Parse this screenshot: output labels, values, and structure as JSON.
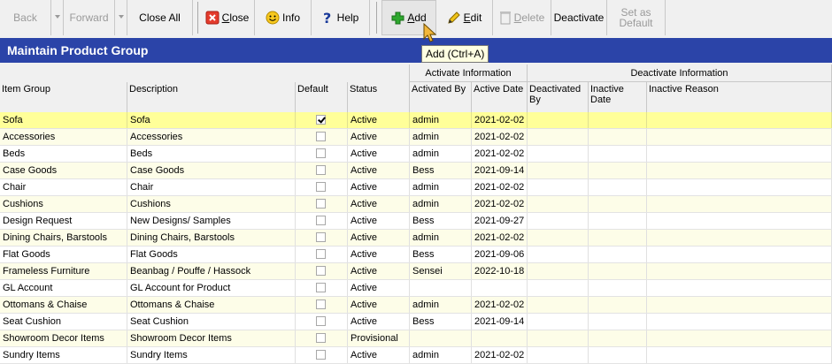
{
  "toolbar": {
    "back": "Back",
    "forward": "Forward",
    "close_all": "Close All",
    "close": "Close",
    "close_mnemonic": "C",
    "info": "Info",
    "help": "Help",
    "add": "Add",
    "add_mnemonic": "A",
    "edit": "Edit",
    "edit_mnemonic": "E",
    "delete": "Delete",
    "delete_mnemonic": "D",
    "deactivate": "Deactivate",
    "set_as_default_line1": "Set as",
    "set_as_default_line2": "Default"
  },
  "tooltip": "Add (Ctrl+A)",
  "page_title": "Maintain Product Group",
  "grid": {
    "group_headers": {
      "activate": "Activate Information",
      "deactivate": "Deactivate Information"
    },
    "columns": {
      "item_group": "Item Group",
      "description": "Description",
      "default": "Default",
      "status": "Status",
      "activated_by": "Activated By",
      "active_date": "Active Date",
      "deactivated_by_1": "Deactivated",
      "deactivated_by_2": "By",
      "inactive_date_1": "Inactive",
      "inactive_date_2": "Date",
      "inactive_reason": "Inactive Reason"
    },
    "rows": [
      {
        "group": "Sofa",
        "description": "Sofa",
        "default": true,
        "status": "Active",
        "activated_by": "admin",
        "active_date": "2021-02-02"
      },
      {
        "group": "Accessories",
        "description": "Accessories",
        "default": false,
        "status": "Active",
        "activated_by": "admin",
        "active_date": "2021-02-02"
      },
      {
        "group": "Beds",
        "description": "Beds",
        "default": false,
        "status": "Active",
        "activated_by": "admin",
        "active_date": "2021-02-02"
      },
      {
        "group": "Case Goods",
        "description": "Case Goods",
        "default": false,
        "status": "Active",
        "activated_by": "Bess",
        "active_date": "2021-09-14"
      },
      {
        "group": "Chair",
        "description": "Chair",
        "default": false,
        "status": "Active",
        "activated_by": "admin",
        "active_date": "2021-02-02"
      },
      {
        "group": "Cushions",
        "description": "Cushions",
        "default": false,
        "status": "Active",
        "activated_by": "admin",
        "active_date": "2021-02-02"
      },
      {
        "group": "Design Request",
        "description": "New Designs/ Samples",
        "default": false,
        "status": "Active",
        "activated_by": "Bess",
        "active_date": "2021-09-27"
      },
      {
        "group": "Dining Chairs, Barstools",
        "description": "Dining Chairs, Barstools",
        "default": false,
        "status": "Active",
        "activated_by": "admin",
        "active_date": "2021-02-02"
      },
      {
        "group": "Flat Goods",
        "description": "Flat Goods",
        "default": false,
        "status": "Active",
        "activated_by": "Bess",
        "active_date": "2021-09-06"
      },
      {
        "group": "Frameless Furniture",
        "description": "Beanbag / Pouffe / Hassock",
        "default": false,
        "status": "Active",
        "activated_by": "Sensei",
        "active_date": "2022-10-18"
      },
      {
        "group": "GL Account",
        "description": "GL Account for Product",
        "default": false,
        "status": "Active",
        "activated_by": "",
        "active_date": ""
      },
      {
        "group": "Ottomans & Chaise",
        "description": "Ottomans & Chaise",
        "default": false,
        "status": "Active",
        "activated_by": "admin",
        "active_date": "2021-02-02"
      },
      {
        "group": "Seat Cushion",
        "description": "Seat Cushion",
        "default": false,
        "status": "Active",
        "activated_by": "Bess",
        "active_date": "2021-09-14"
      },
      {
        "group": "Showroom Decor Items",
        "description": "Showroom Decor Items",
        "default": false,
        "status": "Provisional",
        "activated_by": "",
        "active_date": ""
      },
      {
        "group": "Sundry Items",
        "description": "Sundry Items",
        "default": false,
        "status": "Active",
        "activated_by": "admin",
        "active_date": "2021-02-02"
      }
    ]
  },
  "colors": {
    "title_bar": "#2b44a8",
    "selected_row": "#ffff99",
    "alt_row": "#fdfde8",
    "tooltip_bg": "#ffffe1"
  }
}
